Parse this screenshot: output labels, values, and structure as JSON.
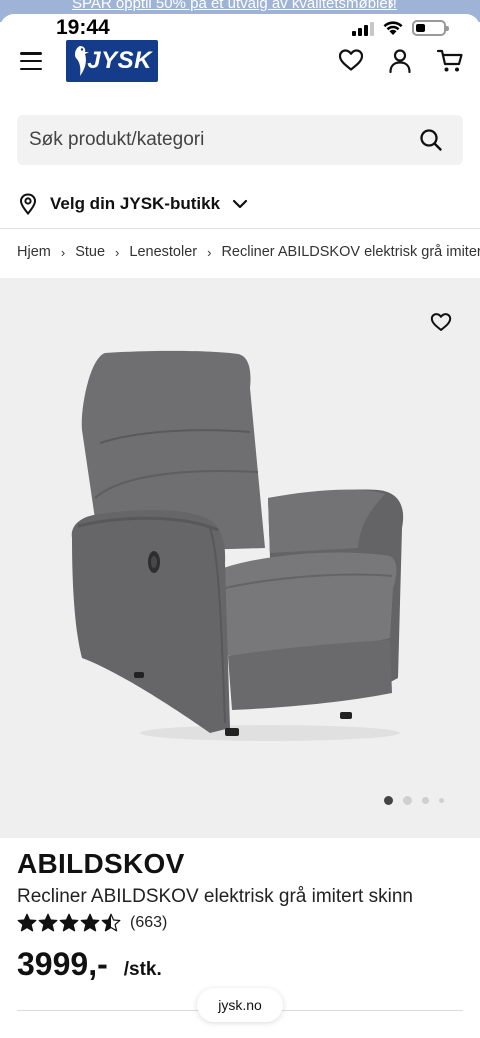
{
  "promo": {
    "text": "SPAR opptil 50% på et utvalg av kvalitetsmøbler!",
    "arrow": "›"
  },
  "status": {
    "time": "19:44",
    "battery_level": 0.35
  },
  "header": {
    "logo_text": "JYSK"
  },
  "search": {
    "placeholder": "Søk produkt/kategori",
    "value": ""
  },
  "store": {
    "label": "Velg din JYSK-butikk"
  },
  "breadcrumb": [
    "Hjem",
    "Stue",
    "Lenestoler",
    "Recliner ABILDSKOV elektrisk grå imitert skinn"
  ],
  "gallery": {
    "image_count": 4,
    "active_index": 0
  },
  "product": {
    "name": "ABILDSKOV",
    "description": "Recliner ABILDSKOV elektrisk grå imitert skinn",
    "rating": 4.5,
    "review_count": "(663)",
    "price": "3999,-",
    "unit": "/stk."
  },
  "browser": {
    "url": "jysk.no"
  },
  "colors": {
    "brand": "#143c8a",
    "promo_bar": "#9fb3d6",
    "gallery_bg": "#efefef",
    "chair": "#6b6b6e"
  }
}
